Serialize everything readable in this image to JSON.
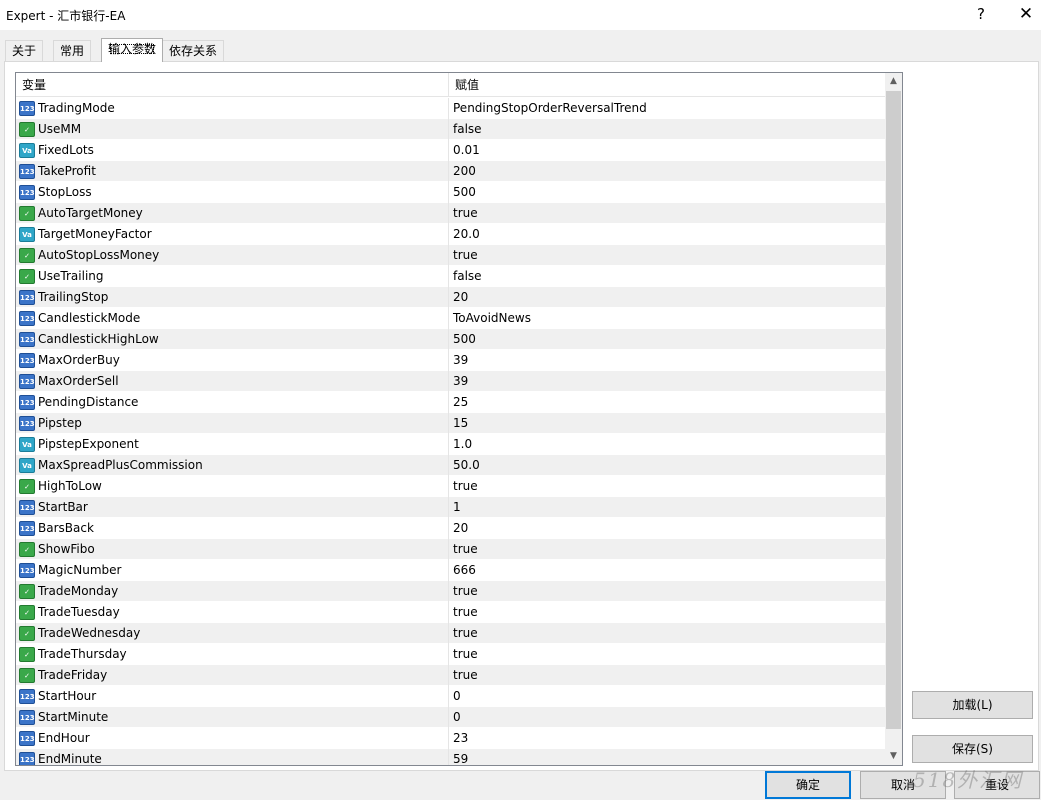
{
  "window": {
    "title": "Expert - 汇市银行-EA",
    "help_glyph": "?",
    "close_glyph": "✕"
  },
  "tabs": [
    {
      "label": "关于"
    },
    {
      "label": "常用"
    },
    {
      "label": "输入参数"
    },
    {
      "label": "依存关系"
    }
  ],
  "grid": {
    "header_variable": "变量",
    "header_value": "赋值",
    "rows": [
      {
        "name": "TradingMode",
        "value": "PendingStopOrderReversalTrend",
        "type": "int"
      },
      {
        "name": "UseMM",
        "value": "false",
        "type": "bool"
      },
      {
        "name": "FixedLots",
        "value": "0.01",
        "type": "dbl"
      },
      {
        "name": "TakeProfit",
        "value": "200",
        "type": "int"
      },
      {
        "name": "StopLoss",
        "value": "500",
        "type": "int"
      },
      {
        "name": "AutoTargetMoney",
        "value": "true",
        "type": "bool"
      },
      {
        "name": "TargetMoneyFactor",
        "value": "20.0",
        "type": "dbl"
      },
      {
        "name": "AutoStopLossMoney",
        "value": "true",
        "type": "bool"
      },
      {
        "name": "UseTrailing",
        "value": "false",
        "type": "bool"
      },
      {
        "name": "TrailingStop",
        "value": "20",
        "type": "int"
      },
      {
        "name": "CandlestickMode",
        "value": "ToAvoidNews",
        "type": "int"
      },
      {
        "name": "CandlestickHighLow",
        "value": "500",
        "type": "int"
      },
      {
        "name": "MaxOrderBuy",
        "value": "39",
        "type": "int"
      },
      {
        "name": "MaxOrderSell",
        "value": "39",
        "type": "int"
      },
      {
        "name": "PendingDistance",
        "value": "25",
        "type": "int"
      },
      {
        "name": "Pipstep",
        "value": "15",
        "type": "int"
      },
      {
        "name": "PipstepExponent",
        "value": "1.0",
        "type": "dbl"
      },
      {
        "name": "MaxSpreadPlusCommission",
        "value": "50.0",
        "type": "dbl"
      },
      {
        "name": "HighToLow",
        "value": "true",
        "type": "bool"
      },
      {
        "name": "StartBar",
        "value": "1",
        "type": "int"
      },
      {
        "name": "BarsBack",
        "value": "20",
        "type": "int"
      },
      {
        "name": "ShowFibo",
        "value": "true",
        "type": "bool"
      },
      {
        "name": "MagicNumber",
        "value": "666",
        "type": "int"
      },
      {
        "name": "TradeMonday",
        "value": "true",
        "type": "bool"
      },
      {
        "name": "TradeTuesday",
        "value": "true",
        "type": "bool"
      },
      {
        "name": "TradeWednesday",
        "value": "true",
        "type": "bool"
      },
      {
        "name": "TradeThursday",
        "value": "true",
        "type": "bool"
      },
      {
        "name": "TradeFriday",
        "value": "true",
        "type": "bool"
      },
      {
        "name": "StartHour",
        "value": "0",
        "type": "int"
      },
      {
        "name": "StartMinute",
        "value": "0",
        "type": "int"
      },
      {
        "name": "EndHour",
        "value": "23",
        "type": "int"
      },
      {
        "name": "EndMinute",
        "value": "59",
        "type": "int"
      }
    ]
  },
  "icons": {
    "int": {
      "name": "integer-type-icon",
      "glyph": "123",
      "color": "#3b74c8"
    },
    "bool": {
      "name": "boolean-type-icon",
      "glyph": "✓",
      "color": "#3aa84a"
    },
    "dbl": {
      "name": "double-type-icon",
      "glyph": "Va",
      "color": "#2fa6c8"
    }
  },
  "scroll": {
    "up_glyph": "▲",
    "down_glyph": "▼"
  },
  "buttons": {
    "load": "加载(L)",
    "save": "保存(S)",
    "ok": "确定",
    "cancel": "取消",
    "reset": "重设"
  },
  "watermark": "518外汇网"
}
